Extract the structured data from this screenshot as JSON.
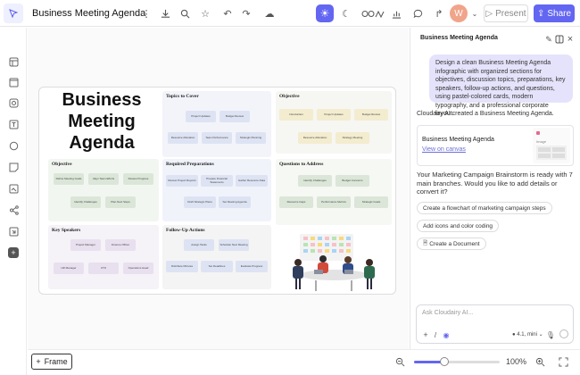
{
  "app": {
    "title": "Business Meeting Agenda"
  },
  "topbar": {
    "present_label": "Present",
    "share_label": "Share",
    "avatar_initial": "W"
  },
  "canvas": {
    "frame_label": "Frame",
    "zoom_text": "100%",
    "zoom_level": 0.35,
    "infographic": {
      "title_lines": [
        "Business",
        "Meeting",
        "Agenda"
      ],
      "sections": [
        {
          "heading": "Topics to Cover",
          "cards": [
            "Project Updates",
            "Budget Review",
            "Resource Allocation",
            "Team Performance",
            "Strategic Planning"
          ]
        },
        {
          "heading": "Objective",
          "cards": [
            "Introduction",
            "Project Updates",
            "Budget Review",
            "Resource Allocation",
            "Strategy Meeting"
          ]
        },
        {
          "heading": "Objective",
          "cards": [
            "Define Meeting Goals",
            "Align Team Efforts",
            "Review Progress",
            "Identify Challenges",
            "Plan Next Steps"
          ]
        },
        {
          "heading": "Required Preparations",
          "cards": [
            "Review Project Reports",
            "Prepare Financial Statements",
            "Gather Resource Data",
            "Draft Strategic Plans",
            "Set Meeting Agenda"
          ]
        },
        {
          "heading": "Questions to Address",
          "cards": [
            "Identify Challenges",
            "Budget Concerns",
            "Resource Gaps",
            "Performance Metrics",
            "Strategic Goals"
          ]
        },
        {
          "heading": "Key Speakers",
          "cards": [
            "Project Manager",
            "Finance Officer",
            "HR Manager",
            "CTO",
            "Operations Head"
          ]
        },
        {
          "heading": "Follow-Up Actions",
          "cards": [
            "Assign Tasks",
            "Schedule Next Meeting",
            "Distribute Minutes",
            "Set Deadlines",
            "Evaluate Progress"
          ]
        }
      ]
    }
  },
  "chat": {
    "header_title": "Business Meeting Agenda",
    "user_message": "Design a clean Business Meeting Agenda infographic with organized sections for objectives, discussion topics, preparations, key speakers, follow-up actions, and questions, using pastel-colored cards, modern typography, and a professional corporate layout.",
    "ai_created": "Cloudairy AI created a Business Meeting Agenda.",
    "card_name": "Business Meeting Agenda",
    "card_link": "View on canvas",
    "thumb_label": "Image",
    "ready_message": "Your Marketing Campaign Brainstorm is ready with 7 main branches. Would you like to add details or convert it?",
    "suggestions": [
      "Create a flowchart of marketing campaign steps",
      "Add icons and color coding",
      "Create a Document"
    ],
    "input_placeholder": "Ask Cloudairy AI...",
    "model_label": "4.1, mini"
  }
}
